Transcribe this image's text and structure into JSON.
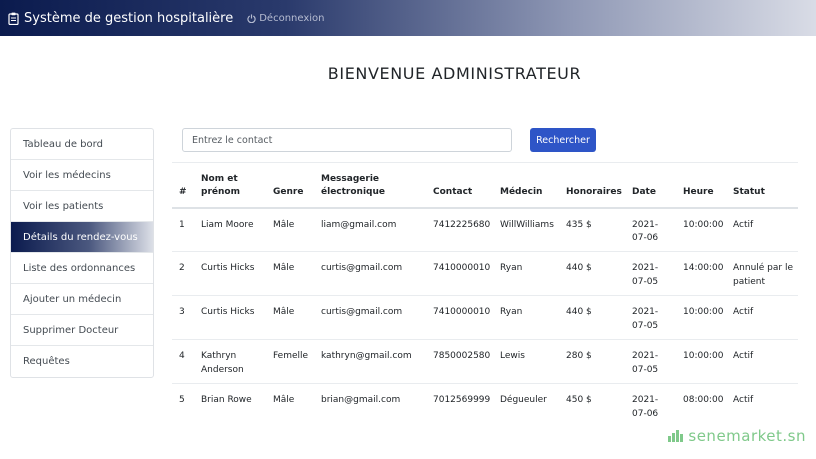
{
  "navbar": {
    "brand": "Système de gestion hospitalière",
    "logout": "Déconnexion"
  },
  "welcome": "BIENVENUE ADMINISTRATEUR",
  "sidebar": {
    "items": [
      {
        "label": "Tableau de bord"
      },
      {
        "label": "Voir les médecins"
      },
      {
        "label": "Voir les patients"
      },
      {
        "label": "Détails du rendez-vous",
        "active": true
      },
      {
        "label": "Liste des ordonnances"
      },
      {
        "label": "Ajouter un médecin"
      },
      {
        "label": "Supprimer Docteur"
      },
      {
        "label": "Requêtes"
      }
    ]
  },
  "search": {
    "placeholder": "Entrez le contact",
    "button": "Rechercher"
  },
  "table": {
    "headers": {
      "num": "#",
      "name": "Nom et prénom",
      "gender": "Genre",
      "email": "Messagerie électronique",
      "contact": "Contact",
      "doctor": "Médecin",
      "fees": "Honoraires",
      "date": "Date",
      "time": "Heure",
      "status": "Statut"
    },
    "rows": [
      {
        "num": "1",
        "name": "Liam Moore",
        "gender": "Mâle",
        "email": "liam@gmail.com",
        "contact": "7412225680",
        "doctor": "WillWilliams",
        "fees": "435 $",
        "date": "2021-07-06",
        "time": "10:00:00",
        "status": "Actif"
      },
      {
        "num": "2",
        "name": "Curtis Hicks",
        "gender": "Mâle",
        "email": "curtis@gmail.com",
        "contact": "7410000010",
        "doctor": "Ryan",
        "fees": "440 $",
        "date": "2021-07-05",
        "time": "14:00:00",
        "status": "Annulé par le patient"
      },
      {
        "num": "3",
        "name": "Curtis Hicks",
        "gender": "Mâle",
        "email": "curtis@gmail.com",
        "contact": "7410000010",
        "doctor": "Ryan",
        "fees": "440 $",
        "date": "2021-07-05",
        "time": "10:00:00",
        "status": "Actif"
      },
      {
        "num": "4",
        "name": "Kathryn Anderson",
        "gender": "Femelle",
        "email": "kathryn@gmail.com",
        "contact": "7850002580",
        "doctor": "Lewis",
        "fees": "280 $",
        "date": "2021-07-05",
        "time": "10:00:00",
        "status": "Actif"
      },
      {
        "num": "5",
        "name": "Brian Rowe",
        "gender": "Mâle",
        "email": "brian@gmail.com",
        "contact": "7012569999",
        "doctor": "Dégueuler",
        "fees": "450 $",
        "date": "2021-07-06",
        "time": "08:00:00",
        "status": "Actif"
      }
    ]
  },
  "watermark": "senemarket.sn",
  "colors": {
    "navbar_start": "#0b1b4e",
    "button": "#2e55c7",
    "watermark": "#7fc98a"
  }
}
